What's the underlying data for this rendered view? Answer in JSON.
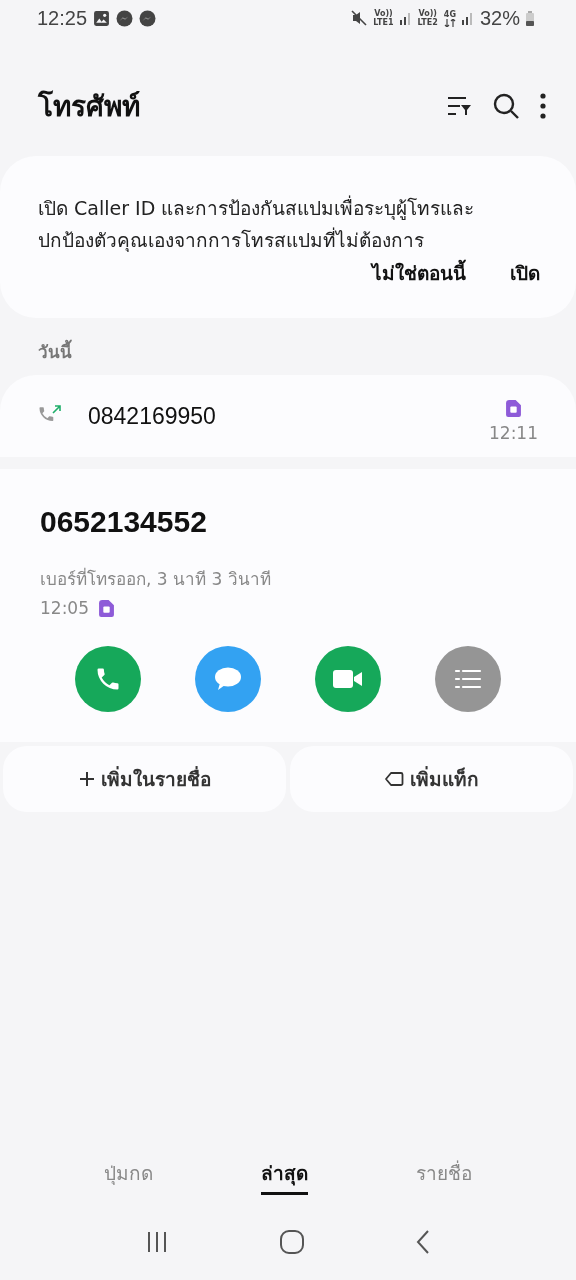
{
  "status_bar": {
    "time": "12:25",
    "sim1": {
      "top": "Vo))",
      "bottom": "LTE1"
    },
    "sim2": {
      "top": "Vo))",
      "bottom": "LTE2"
    },
    "network": "4G",
    "battery": "32%"
  },
  "header": {
    "title": "โทรศัพท์"
  },
  "banner": {
    "text": "เปิด Caller ID และการป้องกันสแปมเพื่อระบุผู้โทรและปกป้องตัวคุณเองจากการโทรสแปมที่ไม่ต้องการ",
    "actions": [
      "ไม่ใช่ตอนนี้",
      "เปิด"
    ]
  },
  "section": "วันนี้",
  "calls": [
    {
      "number": "0842169950",
      "time": "12:11",
      "expanded": false
    },
    {
      "number": "0652134552",
      "detail": "เบอร์ที่โทรออก, 3 นาที 3 วินาที",
      "time": "12:05",
      "expanded": true
    }
  ],
  "actions": [
    {
      "kind": "call",
      "color": "#16a85a"
    },
    {
      "kind": "message",
      "color": "#33a2f2"
    },
    {
      "kind": "video",
      "color": "#16a85a"
    },
    {
      "kind": "details",
      "color": "#959595"
    }
  ],
  "buttons": [
    {
      "kind": "add",
      "label": "เพิ่มในรายชื่อ"
    },
    {
      "kind": "tag",
      "label": "เพิ่มแท็ก"
    }
  ],
  "tabs": [
    {
      "label": "ปุ่มกด",
      "selected": false
    },
    {
      "label": "ล่าสุด",
      "selected": true
    },
    {
      "label": "รายชื่อ",
      "selected": false
    }
  ]
}
